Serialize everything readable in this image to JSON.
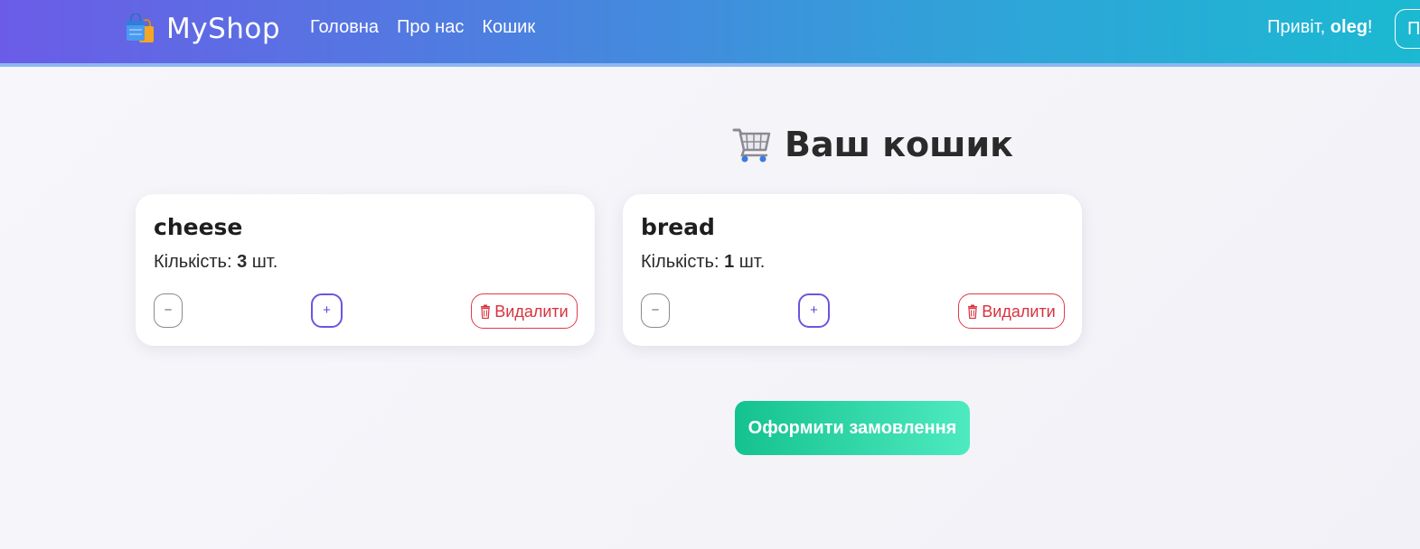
{
  "header": {
    "brand": "MyShop",
    "nav": [
      {
        "label": "Головна"
      },
      {
        "label": "Про нас"
      },
      {
        "label": "Кошик"
      }
    ],
    "greeting_prefix": "Привіт, ",
    "username": "oleg",
    "greeting_suffix": "!",
    "button_label": "П",
    "icons": {
      "brand": "shopping-bags-icon"
    }
  },
  "main": {
    "title": "Ваш кошик",
    "title_icon": "shopping-cart-icon",
    "qty_label": "Кількість: ",
    "qty_unit": " шт.",
    "minus_label": "−",
    "plus_label": "+",
    "delete_label": "Видалити",
    "delete_icon": "trash-icon",
    "items": [
      {
        "name": "cheese",
        "quantity": "3"
      },
      {
        "name": "bread",
        "quantity": "1"
      }
    ],
    "checkout_label": "Оформити замовлення"
  },
  "colors": {
    "accent": "#6a56e0",
    "danger": "#d8323f",
    "checkout_start": "#14c28f",
    "checkout_end": "#4eeac0"
  }
}
